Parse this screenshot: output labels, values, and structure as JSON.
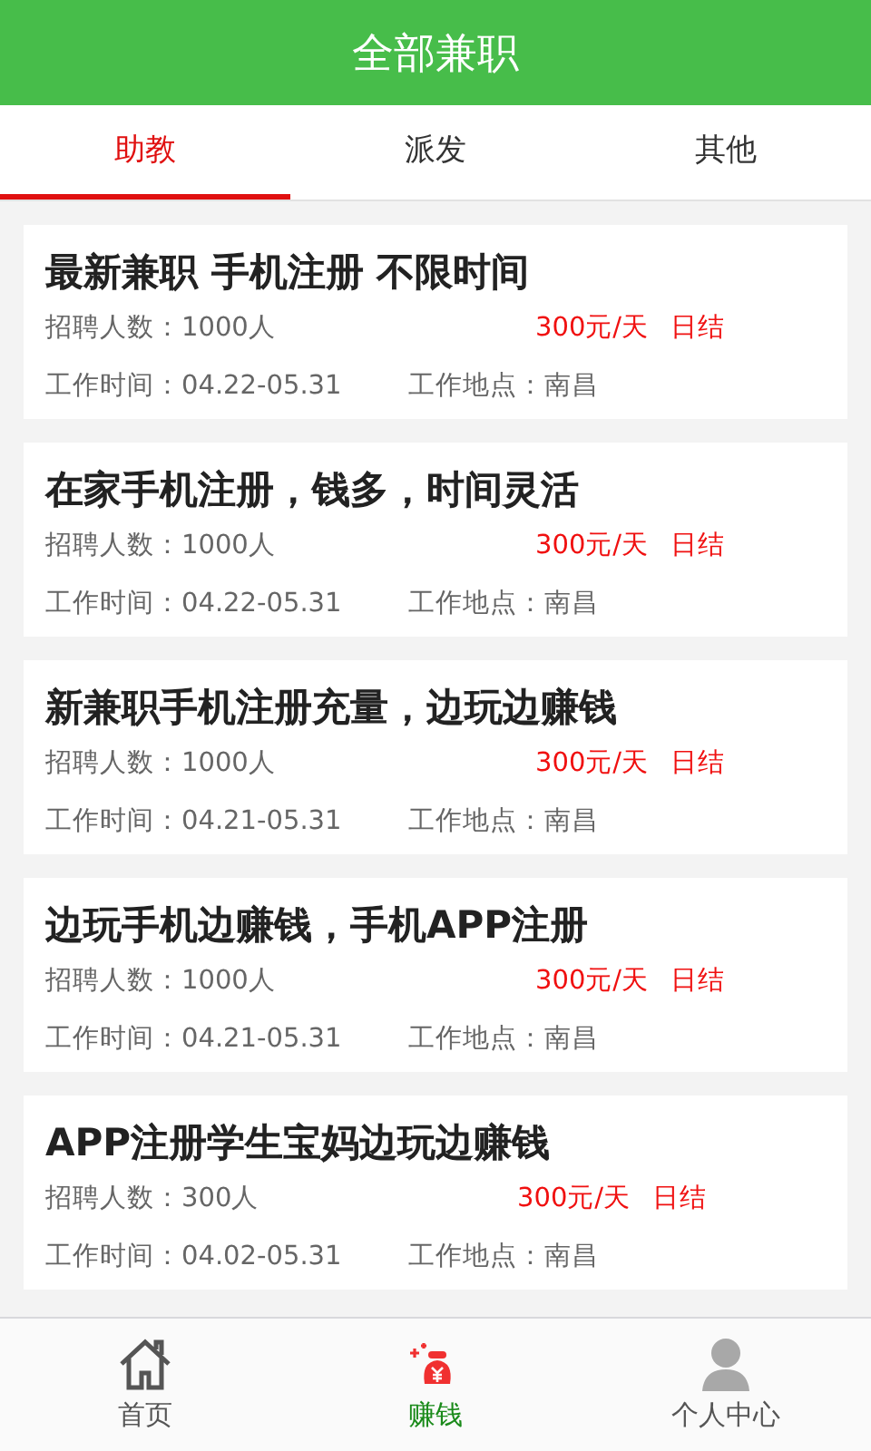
{
  "header": {
    "title": "全部兼职"
  },
  "tabs": [
    {
      "label": "助教",
      "selected": true
    },
    {
      "label": "派发",
      "selected": false
    },
    {
      "label": "其他",
      "selected": false
    }
  ],
  "jobs": [
    {
      "title": "最新兼职 手机注册 不限时间",
      "recruits": "招聘人数：1000人",
      "pay": "300元/天",
      "settle": "日结",
      "period": "工作时间：04.22-05.31",
      "place": "工作地点：南昌"
    },
    {
      "title": "在家手机注册，钱多，时间灵活",
      "recruits": "招聘人数：1000人",
      "pay": "300元/天",
      "settle": "日结",
      "period": "工作时间：04.22-05.31",
      "place": "工作地点：南昌"
    },
    {
      "title": "新兼职手机注册充量，边玩边赚钱",
      "recruits": "招聘人数：1000人",
      "pay": "300元/天",
      "settle": "日结",
      "period": "工作时间：04.21-05.31",
      "place": "工作地点：南昌"
    },
    {
      "title": "边玩手机边赚钱，手机APP注册",
      "recruits": "招聘人数：1000人",
      "pay": "300元/天",
      "settle": "日结",
      "period": "工作时间：04.21-05.31",
      "place": "工作地点：南昌"
    },
    {
      "title": "APP注册学生宝妈边玩边赚钱",
      "recruits": "招聘人数：300人",
      "pay": "300元/天",
      "settle": "日结",
      "period": "工作时间：04.02-05.31",
      "place": "工作地点：南昌"
    }
  ],
  "nav": [
    {
      "label": "首页",
      "kind": "home",
      "selected": false
    },
    {
      "label": "赚钱",
      "kind": "money",
      "selected": true
    },
    {
      "label": "个人中心",
      "kind": "profile",
      "selected": false
    }
  ]
}
